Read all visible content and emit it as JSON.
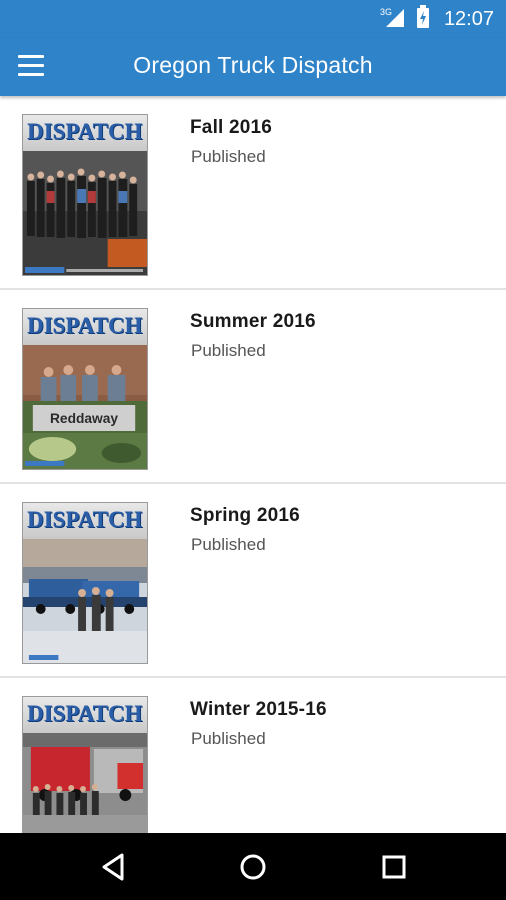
{
  "status_bar": {
    "network": "3G",
    "time": "12:07"
  },
  "app_bar": {
    "title": "Oregon Truck Dispatch",
    "menu_icon": "hamburger-menu-icon"
  },
  "cover_masthead": "DISPATCH",
  "issues": [
    {
      "title": "Fall 2016",
      "status": "Published"
    },
    {
      "title": "Summer 2016",
      "status": "Published",
      "sign_text": "Reddaway"
    },
    {
      "title": "Spring 2016",
      "status": "Published"
    },
    {
      "title": "Winter 2015-16",
      "status": "Published"
    }
  ],
  "nav_bar": {
    "back_icon": "back-triangle-icon",
    "home_icon": "home-circle-icon",
    "recents_icon": "recents-square-icon"
  },
  "colors": {
    "primary": "#2f83c9",
    "text": "#1a1a1a",
    "subtext": "#555555",
    "divider": "#e3e3e3"
  }
}
